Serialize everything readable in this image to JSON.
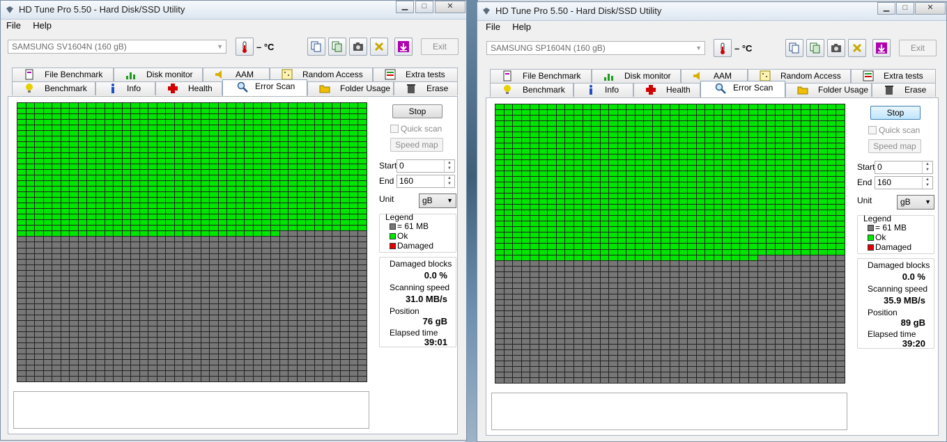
{
  "windows": [
    {
      "title": "HD Tune Pro 5.50 - Hard Disk/SSD Utility",
      "menu": [
        "File",
        "Help"
      ],
      "drive": "SAMSUNG SV1604N (160 gB)",
      "temperature": "– °C",
      "exit_label": "Exit",
      "tabs_top": [
        "File Benchmark",
        "Disk monitor",
        "AAM",
        "Random Access",
        "Extra tests"
      ],
      "tabs_bottom": [
        "Benchmark",
        "Info",
        "Health",
        "Error Scan",
        "Folder Usage",
        "Erase"
      ],
      "active_tab": "Error Scan",
      "scan": {
        "ok_fraction": 0.475,
        "grid_cols": 40,
        "grid_rows": 50
      },
      "controls": {
        "stop_label": "Stop",
        "quick_scan_label": "Quick scan",
        "speed_map_label": "Speed map",
        "start_label": "Start",
        "start_value": "0",
        "end_label": "End",
        "end_value": "160",
        "unit_label": "Unit",
        "unit_value": "gB"
      },
      "legend": {
        "title": "Legend",
        "block": "= 61 MB",
        "ok": "Ok",
        "damaged": "Damaged"
      },
      "stats": {
        "damaged_blocks_label": "Damaged blocks",
        "damaged_blocks": "0.0 %",
        "scanning_speed_label": "Scanning speed",
        "scanning_speed": "31.0 MB/s",
        "position_label": "Position",
        "position": "76 gB",
        "elapsed_label": "Elapsed time",
        "elapsed": "39:01"
      }
    },
    {
      "title": "HD Tune Pro 5.50 - Hard Disk/SSD Utility",
      "menu": [
        "File",
        "Help"
      ],
      "drive": "SAMSUNG SP1604N (160 gB)",
      "temperature": "– °C",
      "exit_label": "Exit",
      "tabs_top": [
        "File Benchmark",
        "Disk monitor",
        "AAM",
        "Random Access",
        "Extra tests"
      ],
      "tabs_bottom": [
        "Benchmark",
        "Info",
        "Health",
        "Error Scan",
        "Folder Usage",
        "Erase"
      ],
      "active_tab": "Error Scan",
      "scan": {
        "ok_fraction": 0.555,
        "grid_cols": 40,
        "grid_rows": 50
      },
      "controls": {
        "stop_label": "Stop",
        "quick_scan_label": "Quick scan",
        "speed_map_label": "Speed map",
        "start_label": "Start",
        "start_value": "0",
        "end_label": "End",
        "end_value": "160",
        "unit_label": "Unit",
        "unit_value": "gB"
      },
      "legend": {
        "title": "Legend",
        "block": "= 61 MB",
        "ok": "Ok",
        "damaged": "Damaged"
      },
      "stats": {
        "damaged_blocks_label": "Damaged blocks",
        "damaged_blocks": "0.0 %",
        "scanning_speed_label": "Scanning speed",
        "scanning_speed": "35.9 MB/s",
        "position_label": "Position",
        "position": "89 gB",
        "elapsed_label": "Elapsed time",
        "elapsed": "39:20"
      }
    }
  ],
  "colors": {
    "ok": "#00e600",
    "empty": "#777777",
    "damaged": "#e00000"
  },
  "icons": [
    "app-icon",
    "thermometer-icon",
    "copy-icon",
    "copy-all-icon",
    "camera-icon",
    "options-icon",
    "save-icon"
  ]
}
